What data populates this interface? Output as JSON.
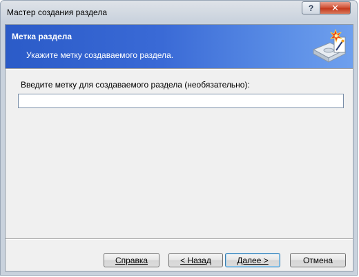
{
  "window": {
    "title": "Мастер создания раздела"
  },
  "title_controls": {
    "help": "?",
    "close": "✕"
  },
  "header": {
    "title": "Метка раздела",
    "subtitle": "Укажите метку создаваемого раздела.",
    "icon": "disk-wizard-icon"
  },
  "form": {
    "prompt": "Введите метку для создаваемого раздела (необязательно):",
    "label_value": "",
    "label_placeholder": ""
  },
  "buttons": {
    "help": "Справка",
    "back": "< Назад",
    "next": "Далее >",
    "cancel": "Отмена"
  }
}
